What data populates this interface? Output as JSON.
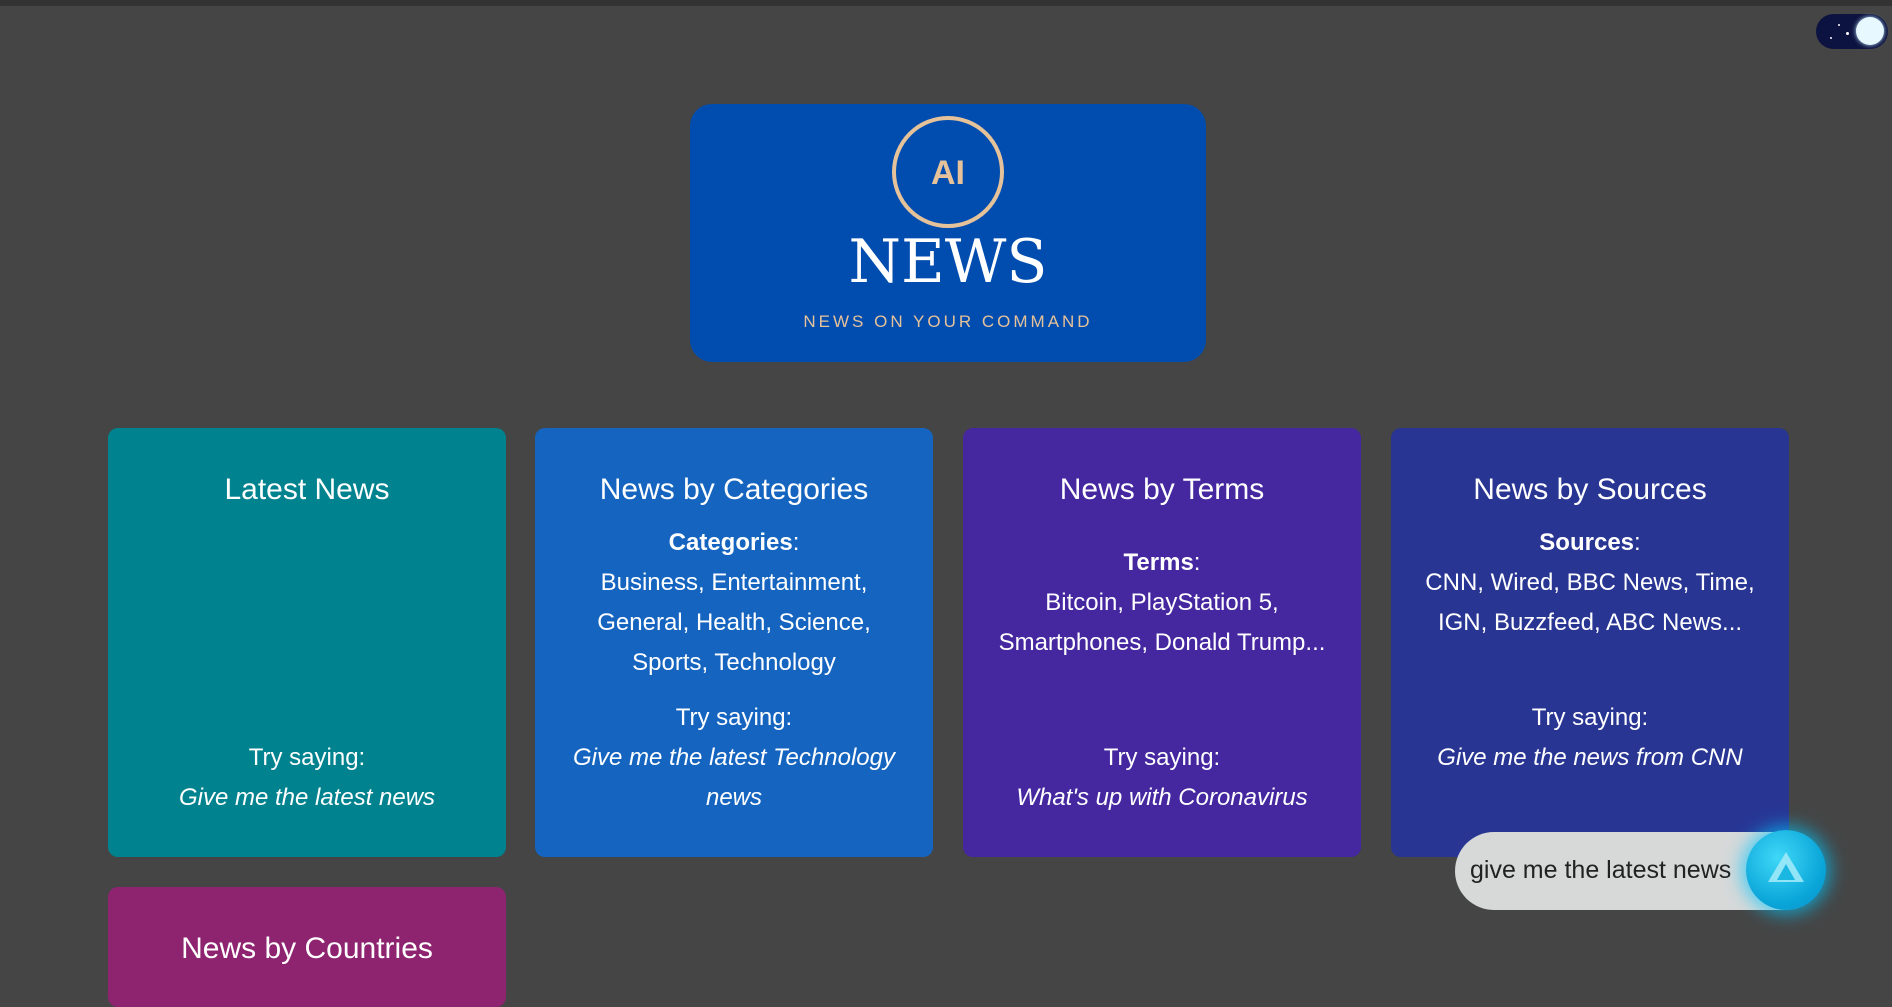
{
  "theme_toggle": {
    "icon": "moon-stars-icon",
    "state": "dark"
  },
  "logo": {
    "badge": "AI",
    "title": "NEWS",
    "tagline": "NEWS ON YOUR COMMAND"
  },
  "cards": [
    {
      "title": "Latest News",
      "try_label": "Try saying:",
      "try_example": "Give me the latest news"
    },
    {
      "title": "News by Categories",
      "info_label": "Categories",
      "info_text": "Business, Entertainment, General, Health, Science, Sports, Technology",
      "try_label": "Try saying:",
      "try_example": "Give me the latest Technology news"
    },
    {
      "title": "News by Terms",
      "info_label": "Terms",
      "info_text": "Bitcoin, PlayStation 5, Smartphones, Donald Trump...",
      "try_label": "Try saying:",
      "try_example": "What's up with Coronavirus"
    },
    {
      "title": "News by Sources",
      "info_label": "Sources",
      "info_text": "CNN, Wired, BBC News, Time, IGN, Buzzfeed, ABC News...",
      "try_label": "Try saying:",
      "try_example": "Give me the news from CNN"
    },
    {
      "title": "News by Countries"
    }
  ],
  "voice_assistant": {
    "transcript": "give me the latest news",
    "button_icon": "alan-assistant-icon"
  }
}
